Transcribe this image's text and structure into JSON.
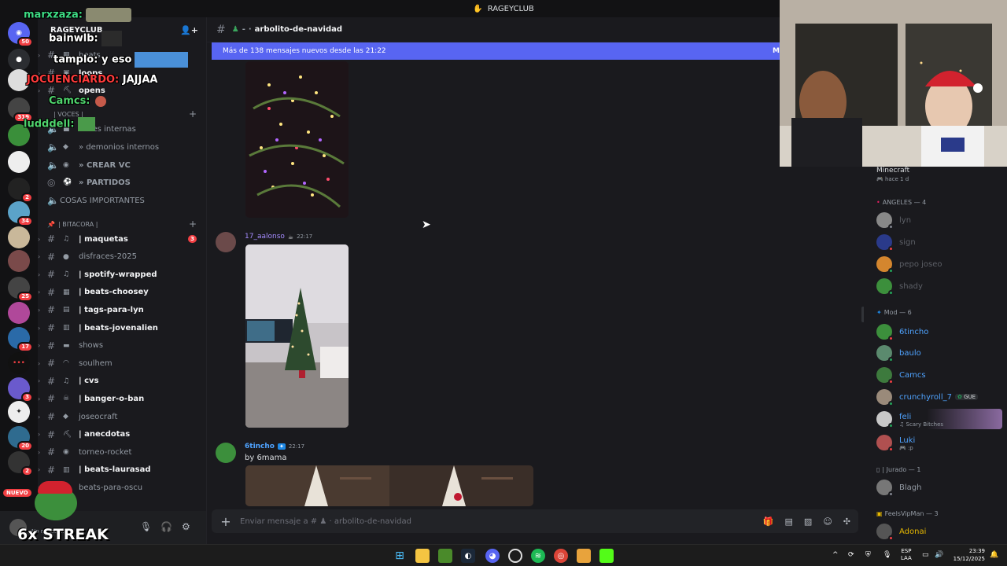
{
  "window": {
    "title": "RAGEYCLUB"
  },
  "server": {
    "name": "RAGEYCLUB"
  },
  "rail_badges": [
    "50",
    "319",
    "2",
    "34",
    "25",
    "17",
    "3",
    "20",
    "2"
  ],
  "rail_new": "NUEVO",
  "sidebar": {
    "top_channels": [
      {
        "name": "beats",
        "unread": false
      },
      {
        "name": "loops",
        "unread": true
      },
      {
        "name": "opens",
        "unread": true
      }
    ],
    "voice_category": "| VOCES |",
    "voice_channels": [
      {
        "name": "voces internas"
      },
      {
        "name": "» demonios internos"
      },
      {
        "name": "» CREAR VC"
      },
      {
        "name": "» PARTIDOS"
      },
      {
        "name": "COSAS IMPORTANTES"
      }
    ],
    "bitacora_category": "| BITACORA |",
    "channels": [
      {
        "name": "| maquetas",
        "unread": true,
        "mention": "3"
      },
      {
        "name": "disfraces-2025",
        "unread": false
      },
      {
        "name": "| spotify-wrapped",
        "unread": true
      },
      {
        "name": "| beats-choosey",
        "unread": true
      },
      {
        "name": "| tags-para-lyn",
        "unread": true
      },
      {
        "name": "| beats-jovenalien",
        "unread": true
      },
      {
        "name": "shows",
        "unread": false
      },
      {
        "name": "soulhem",
        "unread": false
      },
      {
        "name": "| cvs",
        "unread": true
      },
      {
        "name": "| banger-o-ban",
        "unread": true
      },
      {
        "name": "joseocraft",
        "unread": false
      },
      {
        "name": "| anecdotas",
        "unread": true
      },
      {
        "name": "torneo-rocket",
        "unread": false
      },
      {
        "name": "| beats-laurasad",
        "unread": true
      },
      {
        "name": "beats-para-oscu",
        "unread": false
      }
    ]
  },
  "user_panel": {
    "status": "No molestar"
  },
  "channel": {
    "name": "arbolito-de-navidad",
    "prefix": "-"
  },
  "new_messages_bar": {
    "text": "Más de 138 mensajes nuevos desde las 21:22",
    "mark": "M"
  },
  "messages": [
    {
      "author": "17_aalonso",
      "time": "22:17"
    },
    {
      "author": "6tincho",
      "time": "22:17",
      "text": "by 6mama"
    }
  ],
  "composer": {
    "placeholder": "Enviar mensaje a # ♟ · arbolito-de-navidad"
  },
  "members": {
    "activity": {
      "title": "Minecraft",
      "sub": "hace 1 d"
    },
    "groups": [
      {
        "label": "ANGELES — 4",
        "members": [
          "lyn",
          "sign",
          "pepo joseo",
          "shady"
        ]
      },
      {
        "label": "Mod — 6",
        "members": [
          "6tincho",
          "baulo",
          "Camcs",
          "crunchyroll_7",
          "feli",
          "Luki"
        ]
      },
      {
        "label": "| Jurado — 1",
        "members": [
          "Blagh"
        ]
      },
      {
        "label": "FeelsVipMan — 3",
        "members": [
          "Adonai"
        ]
      }
    ],
    "tags": {
      "crunchyroll_7": "GUE"
    },
    "subs": {
      "feli": "Scary Bitches",
      "Luki": ":p"
    }
  },
  "overlay_chat": [
    {
      "user": "marxzaza:",
      "text": "",
      "color": "#3ddc84"
    },
    {
      "user": "bainwlb:",
      "text": "",
      "color": "#ffffff"
    },
    {
      "user": "tamplo:",
      "text": "y eso",
      "color": "#ffffff"
    },
    {
      "user": "JOCUENCIARDO:",
      "text": "JAJJAA",
      "color": "#ff3b3b"
    },
    {
      "user": "Camcs:",
      "text": "",
      "color": "#4fd56d"
    },
    {
      "user": "ludddell:",
      "text": "",
      "color": "#4fd56d"
    }
  ],
  "streak": "6x STREAK",
  "taskbar": {
    "lang": "ESP",
    "lang2": "LAA",
    "time": "23:39",
    "date": "15/12/2025"
  },
  "colors": {
    "blurple": "#5865f2",
    "bg": "#1a1a1e",
    "red": "#f23f43"
  }
}
